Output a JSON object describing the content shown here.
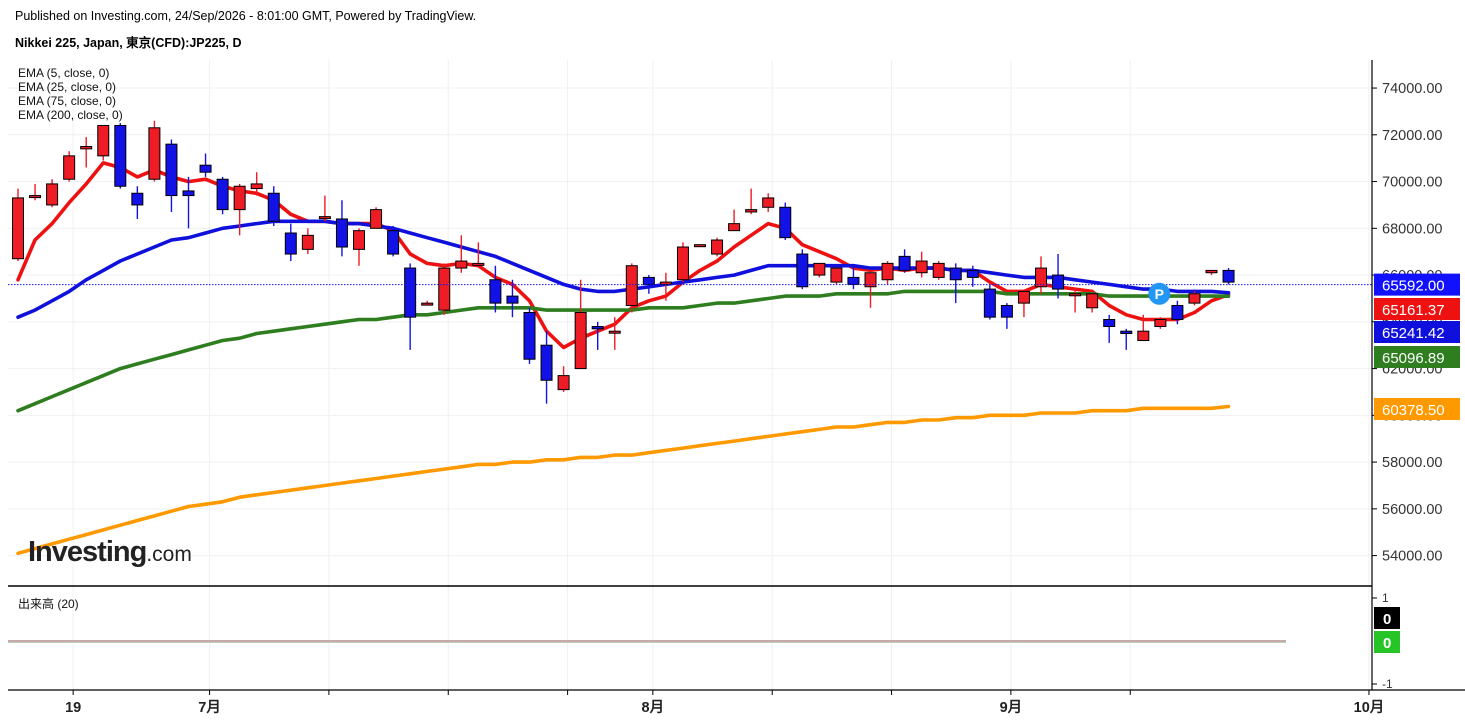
{
  "header": {
    "published": "Published on Investing.com, 24/Sep/2026 - 8:01:00 GMT, Powered by TradingView.",
    "symbol": "Nikkei 225, Japan, 東京(CFD):JP225, D"
  },
  "logo_text": "Investing.com",
  "colors": {
    "up": "#ee1c25",
    "down": "#1212e6",
    "ema5": "#ee1111",
    "ema25": "#1010dd",
    "ema75": "#2e7d1f",
    "ema200": "#ff9900",
    "last_price": "#1111ff",
    "volume_up": "#26c426",
    "volume_zero": "#000000"
  },
  "chart_data": {
    "type": "candlestick",
    "indicator_legend": [
      "EMA (5, close, 0)",
      "EMA (25, close, 0)",
      "EMA (75, close, 0)",
      "EMA (200, close, 0)"
    ],
    "y_ticks": [
      54000,
      56000,
      58000,
      60000,
      62000,
      64000,
      66000,
      68000,
      70000,
      72000,
      74000
    ],
    "ylim": [
      52700,
      75200
    ],
    "x_ticks": [
      {
        "label": "19",
        "bar": 3
      },
      {
        "label": "7月",
        "bar": 11
      },
      {
        "label": "",
        "bar": 18
      },
      {
        "label": "",
        "bar": 25
      },
      {
        "label": "",
        "bar": 32
      },
      {
        "label": "8月",
        "bar": 37
      },
      {
        "label": "",
        "bar": 44
      },
      {
        "label": "",
        "bar": 51
      },
      {
        "label": "9月",
        "bar": 58
      },
      {
        "label": "",
        "bar": 65
      },
      {
        "label": "10月",
        "bar": 79
      }
    ],
    "candles": [
      {
        "o": 66700,
        "h": 69700,
        "l": 66600,
        "c": 69300
      },
      {
        "o": 69350,
        "h": 69900,
        "l": 69200,
        "c": 69400
      },
      {
        "o": 69000,
        "h": 70100,
        "l": 68900,
        "c": 69900
      },
      {
        "o": 70100,
        "h": 71300,
        "l": 70000,
        "c": 71100
      },
      {
        "o": 71400,
        "h": 71900,
        "l": 70600,
        "c": 71500
      },
      {
        "o": 71100,
        "h": 72300,
        "l": 70900,
        "c": 72400
      },
      {
        "o": 72400,
        "h": 72500,
        "l": 69700,
        "c": 69800
      },
      {
        "o": 69500,
        "h": 69800,
        "l": 68400,
        "c": 69000
      },
      {
        "o": 70100,
        "h": 72600,
        "l": 70000,
        "c": 72300
      },
      {
        "o": 71600,
        "h": 71800,
        "l": 68700,
        "c": 69400
      },
      {
        "o": 69600,
        "h": 70200,
        "l": 68000,
        "c": 69400
      },
      {
        "o": 70700,
        "h": 71200,
        "l": 70200,
        "c": 70400
      },
      {
        "o": 70100,
        "h": 70200,
        "l": 68600,
        "c": 68800
      },
      {
        "o": 68800,
        "h": 69900,
        "l": 67700,
        "c": 69800
      },
      {
        "o": 69700,
        "h": 70400,
        "l": 69400,
        "c": 69900
      },
      {
        "o": 69500,
        "h": 69800,
        "l": 68100,
        "c": 68300
      },
      {
        "o": 67800,
        "h": 68200,
        "l": 66600,
        "c": 66900
      },
      {
        "o": 67100,
        "h": 68000,
        "l": 66900,
        "c": 67700
      },
      {
        "o": 68500,
        "h": 69400,
        "l": 68300,
        "c": 68500
      },
      {
        "o": 68400,
        "h": 69200,
        "l": 66800,
        "c": 67200
      },
      {
        "o": 67100,
        "h": 68000,
        "l": 66400,
        "c": 67900
      },
      {
        "o": 68000,
        "h": 68900,
        "l": 68000,
        "c": 68800
      },
      {
        "o": 67900,
        "h": 68100,
        "l": 66800,
        "c": 66900
      },
      {
        "o": 66300,
        "h": 66500,
        "l": 62800,
        "c": 64200
      },
      {
        "o": 64800,
        "h": 64900,
        "l": 64700,
        "c": 64800
      },
      {
        "o": 64500,
        "h": 66500,
        "l": 64300,
        "c": 66300
      },
      {
        "o": 66300,
        "h": 67700,
        "l": 66100,
        "c": 66600
      },
      {
        "o": 66500,
        "h": 67400,
        "l": 66400,
        "c": 66500
      },
      {
        "o": 65800,
        "h": 66400,
        "l": 64400,
        "c": 64800
      },
      {
        "o": 65100,
        "h": 65800,
        "l": 64200,
        "c": 64800
      },
      {
        "o": 64400,
        "h": 64600,
        "l": 62200,
        "c": 62400
      },
      {
        "o": 63000,
        "h": 63600,
        "l": 60500,
        "c": 61500
      },
      {
        "o": 61100,
        "h": 62100,
        "l": 61000,
        "c": 61700
      },
      {
        "o": 62000,
        "h": 65800,
        "l": 62000,
        "c": 64400
      },
      {
        "o": 63800,
        "h": 64000,
        "l": 62800,
        "c": 63700
      },
      {
        "o": 63600,
        "h": 64200,
        "l": 62800,
        "c": 63600
      },
      {
        "o": 64700,
        "h": 66500,
        "l": 64400,
        "c": 66400
      },
      {
        "o": 65900,
        "h": 66000,
        "l": 65200,
        "c": 65600
      },
      {
        "o": 65600,
        "h": 66100,
        "l": 64900,
        "c": 65700
      },
      {
        "o": 65800,
        "h": 67400,
        "l": 65700,
        "c": 67200
      },
      {
        "o": 67300,
        "h": 67300,
        "l": 67200,
        "c": 67300
      },
      {
        "o": 66900,
        "h": 67600,
        "l": 66800,
        "c": 67500
      },
      {
        "o": 67900,
        "h": 68800,
        "l": 67900,
        "c": 68200
      },
      {
        "o": 68700,
        "h": 69700,
        "l": 68600,
        "c": 68800
      },
      {
        "o": 68900,
        "h": 69500,
        "l": 68700,
        "c": 69300
      },
      {
        "o": 68900,
        "h": 69100,
        "l": 67500,
        "c": 67600
      },
      {
        "o": 66900,
        "h": 67100,
        "l": 65400,
        "c": 65500
      },
      {
        "o": 66000,
        "h": 66500,
        "l": 65900,
        "c": 66500
      },
      {
        "o": 65700,
        "h": 66300,
        "l": 65600,
        "c": 66300
      },
      {
        "o": 65900,
        "h": 66400,
        "l": 65400,
        "c": 65600
      },
      {
        "o": 65500,
        "h": 66100,
        "l": 64600,
        "c": 66100
      },
      {
        "o": 65800,
        "h": 66600,
        "l": 65600,
        "c": 66500
      },
      {
        "o": 66800,
        "h": 67100,
        "l": 66100,
        "c": 66200
      },
      {
        "o": 66100,
        "h": 67000,
        "l": 65900,
        "c": 66600
      },
      {
        "o": 65900,
        "h": 66600,
        "l": 65800,
        "c": 66500
      },
      {
        "o": 66300,
        "h": 66500,
        "l": 64800,
        "c": 65800
      },
      {
        "o": 66200,
        "h": 66400,
        "l": 65500,
        "c": 65900
      },
      {
        "o": 65400,
        "h": 65600,
        "l": 64100,
        "c": 64200
      },
      {
        "o": 64700,
        "h": 64800,
        "l": 63700,
        "c": 64200
      },
      {
        "o": 64800,
        "h": 65300,
        "l": 64200,
        "c": 65300
      },
      {
        "o": 65500,
        "h": 66800,
        "l": 65200,
        "c": 66300
      },
      {
        "o": 66000,
        "h": 66900,
        "l": 65000,
        "c": 65400
      },
      {
        "o": 65200,
        "h": 65400,
        "l": 64400,
        "c": 65200
      },
      {
        "o": 64600,
        "h": 64900,
        "l": 64400,
        "c": 65200
      },
      {
        "o": 64100,
        "h": 64300,
        "l": 63100,
        "c": 63800
      },
      {
        "o": 63600,
        "h": 63700,
        "l": 62800,
        "c": 63500
      },
      {
        "o": 63200,
        "h": 64300,
        "l": 63200,
        "c": 63600
      },
      {
        "o": 63800,
        "h": 64200,
        "l": 63700,
        "c": 64100
      },
      {
        "o": 64700,
        "h": 64900,
        "l": 63900,
        "c": 64100
      },
      {
        "o": 64800,
        "h": 65300,
        "l": 64700,
        "c": 65200
      },
      {
        "o": 66100,
        "h": 66200,
        "l": 66000,
        "c": 66200
      },
      {
        "o": 66200,
        "h": 66300,
        "l": 65600,
        "c": 65700
      }
    ],
    "ema_series": [
      {
        "label": "65161.37",
        "color_key": "ema5",
        "values": [
          65800,
          67500,
          68200,
          69100,
          69900,
          70800,
          70600,
          70200,
          70500,
          70200,
          70000,
          70100,
          69800,
          69600,
          69500,
          69200,
          68600,
          68300,
          68300,
          68200,
          68200,
          68200,
          67900,
          66900,
          66500,
          66400,
          66500,
          66400,
          65900,
          65600,
          64900,
          63600,
          62900,
          63300,
          63600,
          63900,
          64600,
          64900,
          65100,
          65700,
          66200,
          66600,
          67200,
          67700,
          68200,
          68000,
          67300,
          67000,
          66700,
          66300,
          66200,
          66300,
          66200,
          66300,
          66300,
          66200,
          66200,
          65700,
          65300,
          65300,
          65600,
          65500,
          65400,
          65300,
          64700,
          64300,
          64100,
          64100,
          64100,
          64400,
          64900,
          65161
        ]
      },
      {
        "label": "65241.42",
        "color_key": "ema25",
        "values": [
          64200,
          64500,
          64900,
          65300,
          65800,
          66200,
          66600,
          66900,
          67200,
          67500,
          67600,
          67800,
          68000,
          68100,
          68200,
          68300,
          68300,
          68300,
          68300,
          68200,
          68200,
          68100,
          68000,
          67800,
          67600,
          67400,
          67200,
          67000,
          66800,
          66500,
          66200,
          65900,
          65600,
          65400,
          65300,
          65300,
          65400,
          65500,
          65600,
          65700,
          65800,
          65900,
          66000,
          66200,
          66400,
          66400,
          66400,
          66400,
          66400,
          66400,
          66300,
          66300,
          66300,
          66300,
          66300,
          66200,
          66200,
          66100,
          66000,
          65900,
          65900,
          65900,
          65800,
          65700,
          65600,
          65500,
          65400,
          65400,
          65300,
          65300,
          65300,
          65241
        ]
      },
      {
        "label": "65096.89",
        "color_key": "ema75",
        "values": [
          60200,
          60500,
          60800,
          61100,
          61400,
          61700,
          62000,
          62200,
          62400,
          62600,
          62800,
          63000,
          63200,
          63300,
          63500,
          63600,
          63700,
          63800,
          63900,
          64000,
          64100,
          64100,
          64200,
          64300,
          64300,
          64400,
          64500,
          64600,
          64600,
          64600,
          64600,
          64500,
          64500,
          64500,
          64500,
          64500,
          64500,
          64600,
          64600,
          64600,
          64700,
          64800,
          64800,
          64900,
          65000,
          65100,
          65100,
          65100,
          65200,
          65200,
          65200,
          65200,
          65300,
          65300,
          65300,
          65300,
          65300,
          65300,
          65200,
          65200,
          65200,
          65200,
          65200,
          65200,
          65100,
          65100,
          65100,
          65100,
          65100,
          65100,
          65100,
          65097
        ]
      },
      {
        "label": "60378.50",
        "color_key": "ema200",
        "values": [
          54100,
          54300,
          54500,
          54700,
          54900,
          55100,
          55300,
          55500,
          55700,
          55900,
          56100,
          56200,
          56300,
          56500,
          56600,
          56700,
          56800,
          56900,
          57000,
          57100,
          57200,
          57300,
          57400,
          57500,
          57600,
          57700,
          57800,
          57900,
          57900,
          58000,
          58000,
          58100,
          58100,
          58200,
          58200,
          58300,
          58300,
          58400,
          58500,
          58600,
          58700,
          58800,
          58900,
          59000,
          59100,
          59200,
          59300,
          59400,
          59500,
          59500,
          59600,
          59700,
          59700,
          59800,
          59800,
          59900,
          59900,
          60000,
          60000,
          60000,
          60100,
          60100,
          60100,
          60200,
          60200,
          60200,
          60300,
          60300,
          60300,
          60300,
          60300,
          60379
        ]
      }
    ],
    "last_price": {
      "value": 65592.0,
      "label": "65592.00"
    },
    "marker": {
      "letter": "P",
      "bar": 66,
      "value": 65200
    },
    "volume_pane": {
      "title": "出来高 (20)",
      "y_ticks": [
        {
          "label": "1",
          "v": 1
        },
        {
          "label": "-1",
          "v": -1
        }
      ],
      "badges": [
        {
          "label": "0",
          "color_key": "volume_zero"
        },
        {
          "label": "0",
          "color_key": "volume_up"
        }
      ]
    }
  }
}
